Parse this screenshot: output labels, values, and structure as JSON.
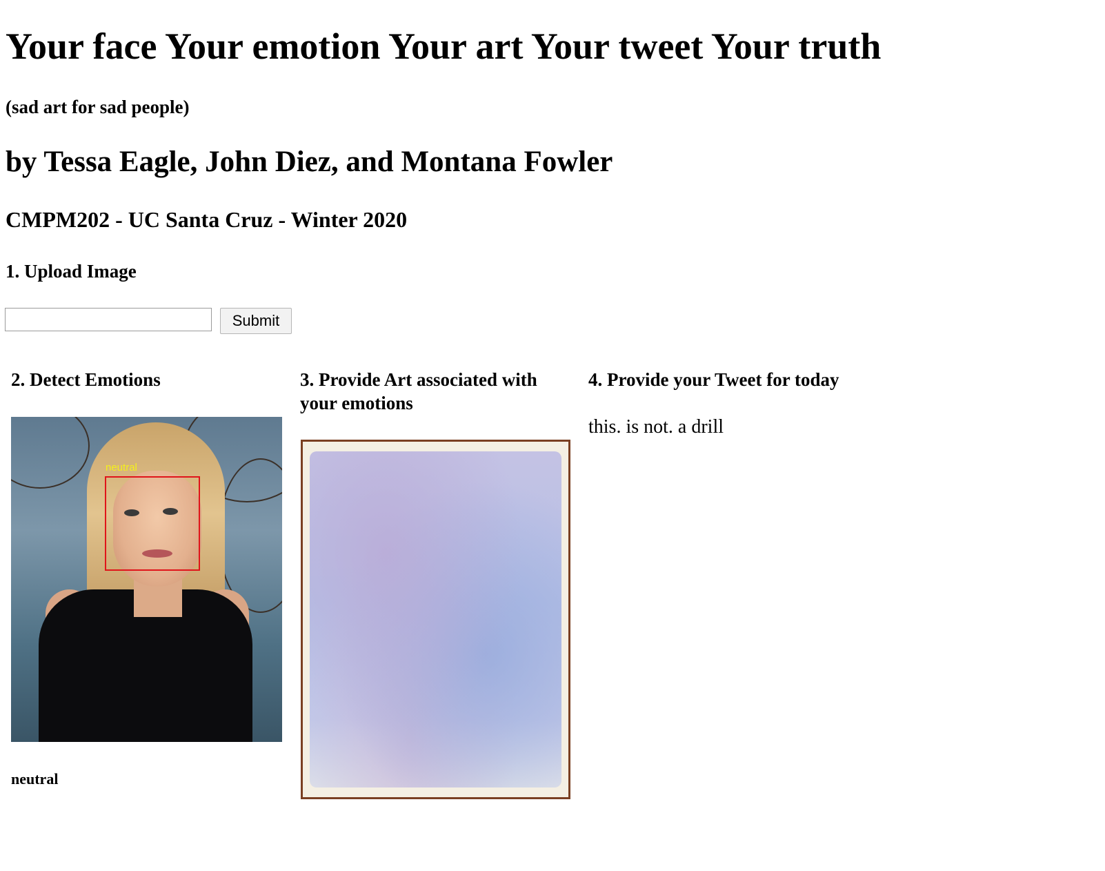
{
  "header": {
    "title": "Your face Your emotion Your art Your tweet Your truth",
    "subtitle": "(sad art for sad people)",
    "authors": "by Tessa Eagle, John Diez, and Montana Fowler",
    "course": "CMPM202 - UC Santa Cruz - Winter 2020"
  },
  "upload": {
    "heading": "1. Upload Image",
    "input_value": "",
    "submit_label": "Submit"
  },
  "detect": {
    "heading": "2. Detect Emotions",
    "face_label": "neutral",
    "result": "neutral"
  },
  "art": {
    "heading": "3. Provide Art associated with your emotions"
  },
  "tweet": {
    "heading": "4. Provide your Tweet for today",
    "text": "this. is not. a drill"
  },
  "colors": {
    "face_box": "#e0141a",
    "face_label": "#f4f01a",
    "frame": "#7a3f22"
  }
}
